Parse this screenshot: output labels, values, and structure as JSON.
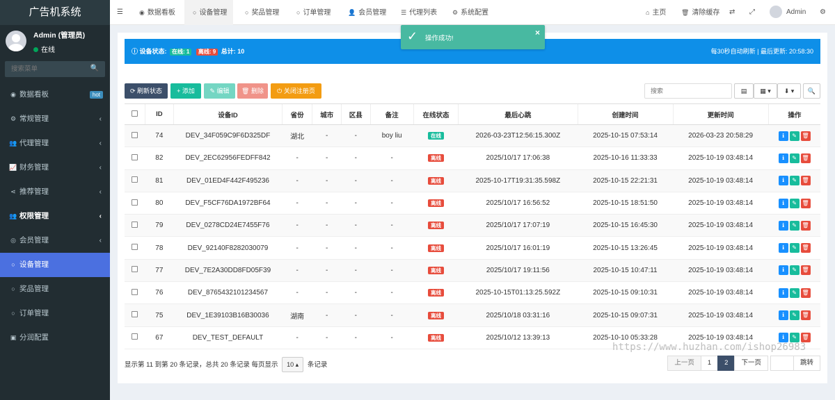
{
  "app": {
    "title": "广告机系统"
  },
  "user": {
    "name": "Admin (管理员)",
    "status": "在线"
  },
  "sidebar": {
    "search_placeholder": "搜索菜单",
    "items": [
      {
        "icon": "dashboard-icon",
        "glyph": "◉",
        "label": "数据看板",
        "badge": "hot",
        "arrow": false,
        "state": "normal"
      },
      {
        "icon": "cogs-icon",
        "glyph": "⚙",
        "label": "常规管理",
        "badge": "",
        "arrow": true,
        "state": "normal"
      },
      {
        "icon": "users-icon",
        "glyph": "👥",
        "label": "代理管理",
        "badge": "",
        "arrow": true,
        "state": "normal"
      },
      {
        "icon": "chart-icon",
        "glyph": "📈",
        "label": "财务管理",
        "badge": "",
        "arrow": true,
        "state": "normal"
      },
      {
        "icon": "share-icon",
        "glyph": "⋖",
        "label": "推荐管理",
        "badge": "",
        "arrow": true,
        "state": "normal"
      },
      {
        "icon": "group-icon",
        "glyph": "👥",
        "label": "权限管理",
        "badge": "",
        "arrow": true,
        "state": "bold"
      },
      {
        "icon": "user-circle-icon",
        "glyph": "◎",
        "label": "会员管理",
        "badge": "",
        "arrow": true,
        "state": "normal"
      },
      {
        "icon": "circle-icon",
        "glyph": "○",
        "label": "设备管理",
        "badge": "",
        "arrow": false,
        "state": "active"
      },
      {
        "icon": "circle-icon",
        "glyph": "○",
        "label": "奖品管理",
        "badge": "",
        "arrow": false,
        "state": "normal"
      },
      {
        "icon": "circle-icon",
        "glyph": "○",
        "label": "订单管理",
        "badge": "",
        "arrow": false,
        "state": "normal"
      },
      {
        "icon": "money-icon",
        "glyph": "▣",
        "label": "分润配置",
        "badge": "",
        "arrow": false,
        "state": "normal"
      }
    ]
  },
  "topbar": {
    "tabs": [
      {
        "icon": "dashboard-icon",
        "glyph": "◉",
        "label": "数据看板"
      },
      {
        "icon": "circle-icon",
        "glyph": "○",
        "label": "设备管理"
      },
      {
        "icon": "circle-icon",
        "glyph": "○",
        "label": "奖品管理"
      },
      {
        "icon": "circle-icon",
        "glyph": "○",
        "label": "订单管理"
      },
      {
        "icon": "user-icon",
        "glyph": "👤",
        "label": "会员管理"
      },
      {
        "icon": "list-icon",
        "glyph": "☰",
        "label": "代理列表"
      },
      {
        "icon": "gear-icon",
        "glyph": "⚙",
        "label": "系统配置"
      }
    ],
    "active_tab": 1,
    "home_label": "主页",
    "clear_cache_label": "清除缓存",
    "user_label": "Admin"
  },
  "toast": {
    "message": "操作成功!"
  },
  "info_bar": {
    "prefix": "设备状态:",
    "online": "在线: 1",
    "offline": "离线: 9",
    "total": "总计: 10",
    "right_text": "每30秒自动刷新 | 最后更新: 20:58:30"
  },
  "toolbar": {
    "refresh": "刷新状态",
    "add": "添加",
    "edit": "编辑",
    "delete": "删除",
    "close_reg": "关闭注册页",
    "search_placeholder": "搜索"
  },
  "table": {
    "columns": [
      "ID",
      "设备ID",
      "省份",
      "城市",
      "区县",
      "备注",
      "在线状态",
      "最后心跳",
      "创建时间",
      "更新时间",
      "操作"
    ],
    "rows": [
      {
        "id": "74",
        "device": "DEV_34F059C9F6D325DF",
        "province": "湖北",
        "city": "-",
        "district": "-",
        "note": "boy liu",
        "status": "在线",
        "online": true,
        "heartbeat": "2026-03-23T12:56:15.300Z",
        "created": "2025-10-15 07:53:14",
        "updated": "2026-03-23 20:58:29"
      },
      {
        "id": "82",
        "device": "DEV_2EC62956FEDFF842",
        "province": "-",
        "city": "-",
        "district": "-",
        "note": "-",
        "status": "离线",
        "online": false,
        "heartbeat": "2025/10/17 17:06:38",
        "created": "2025-10-16 11:33:33",
        "updated": "2025-10-19 03:48:14"
      },
      {
        "id": "81",
        "device": "DEV_01ED4F442F495236",
        "province": "-",
        "city": "-",
        "district": "-",
        "note": "-",
        "status": "离线",
        "online": false,
        "heartbeat": "2025-10-17T19:31:35.598Z",
        "created": "2025-10-15 22:21:31",
        "updated": "2025-10-19 03:48:14"
      },
      {
        "id": "80",
        "device": "DEV_F5CF76DA1972BF64",
        "province": "-",
        "city": "-",
        "district": "-",
        "note": "-",
        "status": "离线",
        "online": false,
        "heartbeat": "2025/10/17 16:56:52",
        "created": "2025-10-15 18:51:50",
        "updated": "2025-10-19 03:48:14"
      },
      {
        "id": "79",
        "device": "DEV_0278CD24E7455F76",
        "province": "-",
        "city": "-",
        "district": "-",
        "note": "-",
        "status": "离线",
        "online": false,
        "heartbeat": "2025/10/17 17:07:19",
        "created": "2025-10-15 16:45:30",
        "updated": "2025-10-19 03:48:14"
      },
      {
        "id": "78",
        "device": "DEV_92140F8282030079",
        "province": "-",
        "city": "-",
        "district": "-",
        "note": "-",
        "status": "离线",
        "online": false,
        "heartbeat": "2025/10/17 16:01:19",
        "created": "2025-10-15 13:26:45",
        "updated": "2025-10-19 03:48:14"
      },
      {
        "id": "77",
        "device": "DEV_7E2A30DD8FD05F39",
        "province": "-",
        "city": "-",
        "district": "-",
        "note": "-",
        "status": "离线",
        "online": false,
        "heartbeat": "2025/10/17 19:11:56",
        "created": "2025-10-15 10:47:11",
        "updated": "2025-10-19 03:48:14"
      },
      {
        "id": "76",
        "device": "DEV_8765432101234567",
        "province": "-",
        "city": "-",
        "district": "-",
        "note": "-",
        "status": "离线",
        "online": false,
        "heartbeat": "2025-10-15T01:13:25.592Z",
        "created": "2025-10-15 09:10:31",
        "updated": "2025-10-19 03:48:14"
      },
      {
        "id": "75",
        "device": "DEV_1E39103B16B30036",
        "province": "湖南",
        "city": "-",
        "district": "-",
        "note": "-",
        "status": "离线",
        "online": false,
        "heartbeat": "2025/10/18 03:31:16",
        "created": "2025-10-15 09:07:31",
        "updated": "2025-10-19 03:48:14"
      },
      {
        "id": "67",
        "device": "DEV_TEST_DEFAULT",
        "province": "-",
        "city": "-",
        "district": "-",
        "note": "-",
        "status": "离线",
        "online": false,
        "heartbeat": "2025/10/12 13:39:13",
        "created": "2025-10-10 05:33:28",
        "updated": "2025-10-19 03:48:14"
      }
    ]
  },
  "footer": {
    "summary": "显示第 11 到第 20 条记录，总共 20 条记录 每页显示",
    "page_size": "10",
    "suffix": "条记录"
  },
  "pagination": {
    "prev": "上一页",
    "pages": [
      "1",
      "2"
    ],
    "current": "2",
    "next": "下一页",
    "go": "跳转"
  },
  "watermark": "https://www.huzhan.com/ishop26983",
  "colors": {
    "sidebar_bg": "#222d32",
    "active": "#4b70e0",
    "info_bar": "#0e8fe8",
    "success": "#18bc9c",
    "danger": "#e74c3c",
    "primary": "#1890ff",
    "toast": "#48b9a1",
    "warning": "#f39c12"
  }
}
